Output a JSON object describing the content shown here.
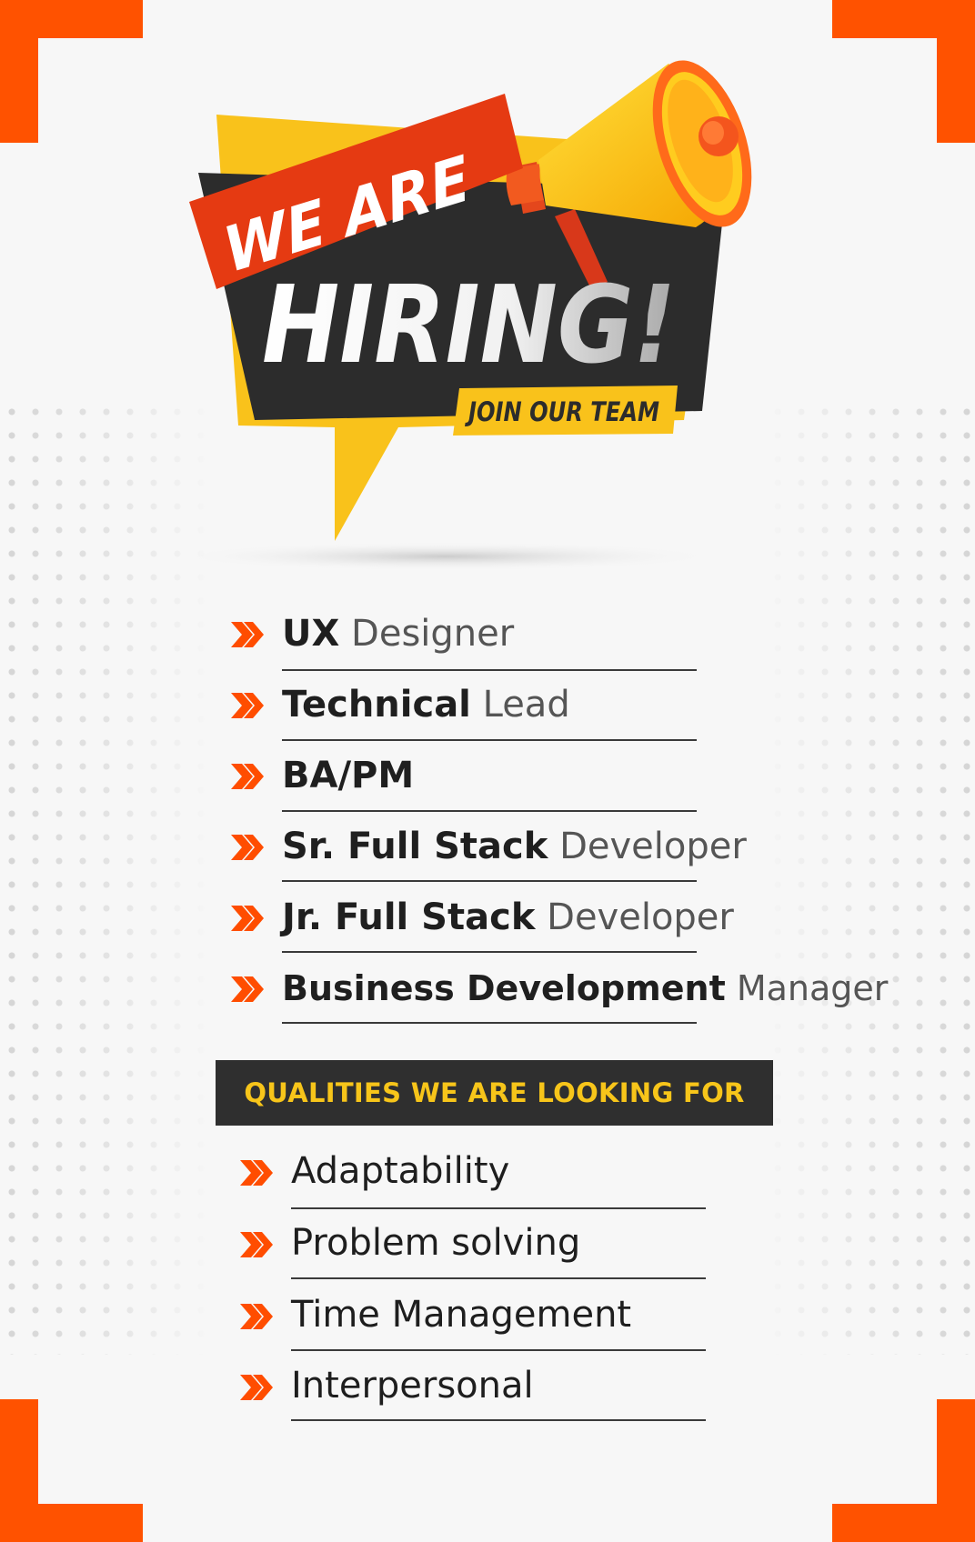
{
  "colors": {
    "accent_orange": "#ff5a00",
    "banner_red": "#e53a12",
    "banner_yellow": "#f9c21b",
    "banner_dark": "#2c2c2c",
    "text_dark": "#1f1f1f",
    "text_gray": "#555555"
  },
  "banner": {
    "line1": "WE ARE",
    "line2": "HIRING!",
    "tagline": "JOIN OUR TEAM",
    "icon": "megaphone-icon"
  },
  "positions": [
    {
      "bold": "UX",
      "light": "Designer"
    },
    {
      "bold": "Technical",
      "light": "Lead"
    },
    {
      "bold": "BA/PM",
      "light": ""
    },
    {
      "bold": "Sr. Full Stack",
      "light": "Developer"
    },
    {
      "bold": "Jr. Full Stack",
      "light": "Developer"
    },
    {
      "bold": "Business Development",
      "light": "Manager"
    }
  ],
  "qualities": {
    "heading": "QUALITIES WE ARE LOOKING FOR",
    "items": [
      "Adaptability",
      "Problem solving",
      "Time Management",
      "Interpersonal"
    ]
  },
  "icons": {
    "bullet": "double-chevron-right-icon"
  }
}
